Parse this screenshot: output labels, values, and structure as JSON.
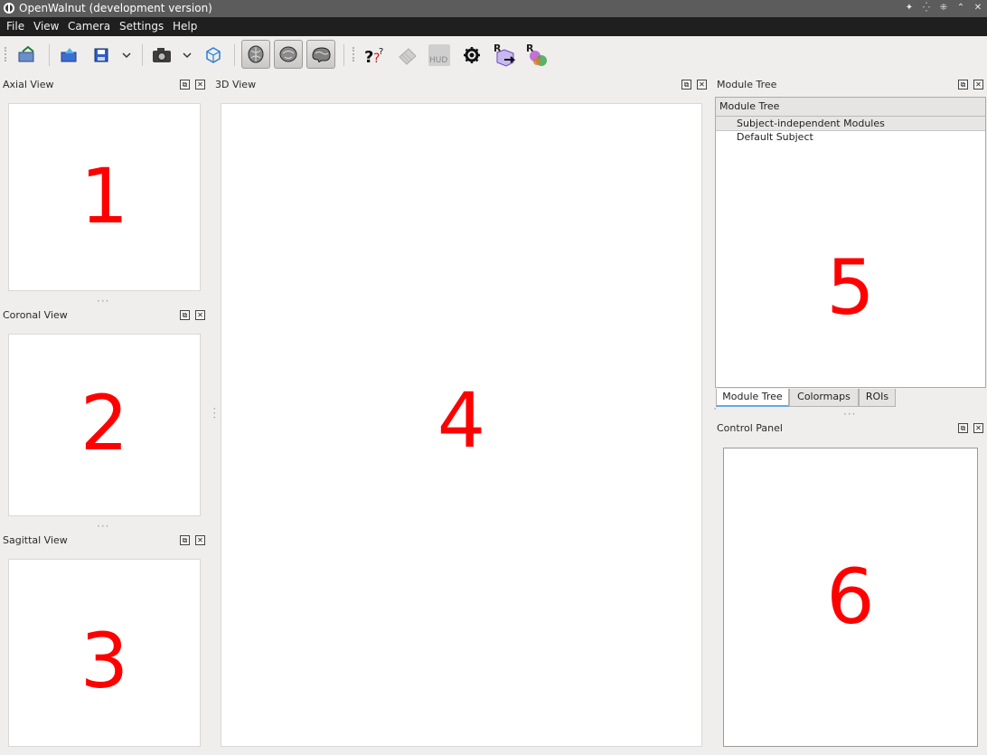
{
  "window": {
    "title": "OpenWalnut (development version)",
    "controls": [
      "pin-icon",
      "shade-icon",
      "restore-icon",
      "maximize-icon",
      "close-icon"
    ]
  },
  "menu": [
    "File",
    "View",
    "Camera",
    "Settings",
    "Help"
  ],
  "toolbar": {
    "icons": [
      "load-dataset-icon",
      "load-project-icon",
      "save-icon",
      "save-menu-chevron-icon",
      "screenshot-icon",
      "screenshot-menu-chevron-icon",
      "reset-view-icon",
      "axial-slice-toggle-icon",
      "coronal-slice-toggle-icon",
      "sagittal-slice-toggle-icon",
      "whats-this-help-icon",
      "disabled-grid-icon",
      "hud-icon",
      "settings-gear-icon",
      "roi-add-icon",
      "roi-remove-icon"
    ],
    "hud_label": "HUD",
    "roi_letter": "R"
  },
  "docks": {
    "axial": {
      "title": "Axial View",
      "number": "1"
    },
    "coronal": {
      "title": "Coronal View",
      "number": "2"
    },
    "sagittal": {
      "title": "Sagittal View",
      "number": "3"
    },
    "view3d": {
      "title": "3D View",
      "number": "4"
    },
    "module_tree": {
      "title": "Module Tree",
      "header": "Module Tree",
      "rows": [
        "Subject-independent Modules",
        "Default Subject"
      ],
      "number": "5"
    },
    "control_panel": {
      "title": "Control Panel",
      "number": "6"
    }
  },
  "tabs": [
    {
      "label": "Module Tree",
      "active": true
    },
    {
      "label": "Colormaps",
      "active": false
    },
    {
      "label": "ROIs",
      "active": false
    }
  ],
  "colors": {
    "annotation": "#ff0000",
    "titlebar": "#5c5c5c",
    "menubar": "#1f1f1f",
    "active_tab_accent": "#6aa7da"
  }
}
